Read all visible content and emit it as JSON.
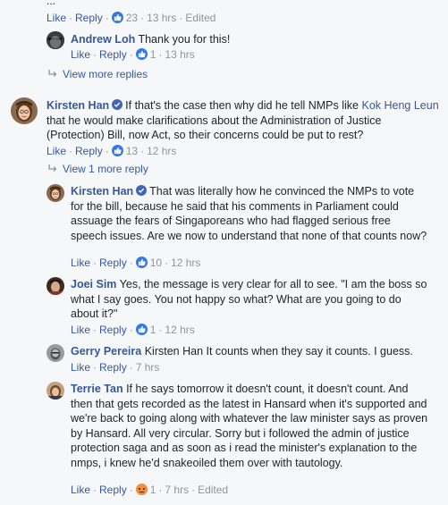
{
  "top": {
    "ellipsis": "...",
    "like": "Like",
    "reply": "Reply",
    "likes": "23",
    "time": "13 hrs",
    "edited": "Edited"
  },
  "comments": [
    {
      "name": "Andrew Loh",
      "text": "Thank you for this!",
      "like": "Like",
      "reply": "Reply",
      "likes": "1",
      "time": "13 hrs"
    },
    {
      "name": "Kirsten Han",
      "text_before": "If that's the case then why did he tell NMPs like ",
      "mention": "Kok Heng Leun",
      "text_after": " that he would make clarifications about the Administration of Justice (Protection) Bill, now Act, so their concerns could be put to rest?",
      "like": "Like",
      "reply": "Reply",
      "likes": "13",
      "time": "12 hrs"
    },
    {
      "name": "Kirsten Han",
      "text": "That was literally how he convinced the NMPs to vote for the bill, because he said that his comments in Parliament could assuage the fears of Singaporeans who had flagged serious free speech issues. Are we now to understand that none of that counts now?",
      "like": "Like",
      "reply": "Reply",
      "likes": "10",
      "time": "12 hrs"
    },
    {
      "name": "Joei Sim",
      "text": "Yes, the message is very clear for all to see. \"I am the boss so what I say goes. You not happy so what? What are you going to do about it?\"",
      "like": "Like",
      "reply": "Reply",
      "likes": "1",
      "time": "12 hrs"
    },
    {
      "name": "Gerry Pereira",
      "text": "Kirsten Han It counts when they say it counts. I guess.",
      "like": "Like",
      "reply": "Reply",
      "time": "7 hrs"
    },
    {
      "name": "Terrie Tan",
      "text": "If he says tomorrow it doesn't count, it doesn't count. And then that gets recorded as the latest in Hansard when it's supported and we're back to going along with whatever the law minister says as proven by Hansard. All very circular. Sorry but i followed the admin of justice protection saga and as soon as i read the minister's explanation to the nmps, i knew he'd snakeoiled them over with tautology.",
      "like": "Like",
      "reply": "Reply",
      "likes": "1",
      "time": "7 hrs",
      "edited": "Edited"
    }
  ],
  "view_more_replies": "View more replies",
  "view_1_more_reply": "View 1 more reply",
  "icons": {
    "like": "thumbs-up-icon",
    "angry": "angry-reaction-icon",
    "verified": "verified-badge-icon",
    "reply_arrow": "reply-arrow-icon"
  },
  "colors": {
    "name": "#365899",
    "like_badge": "#3578e5",
    "background": "#f6f7f9",
    "text": "#1d2129",
    "muted": "#90949c"
  }
}
